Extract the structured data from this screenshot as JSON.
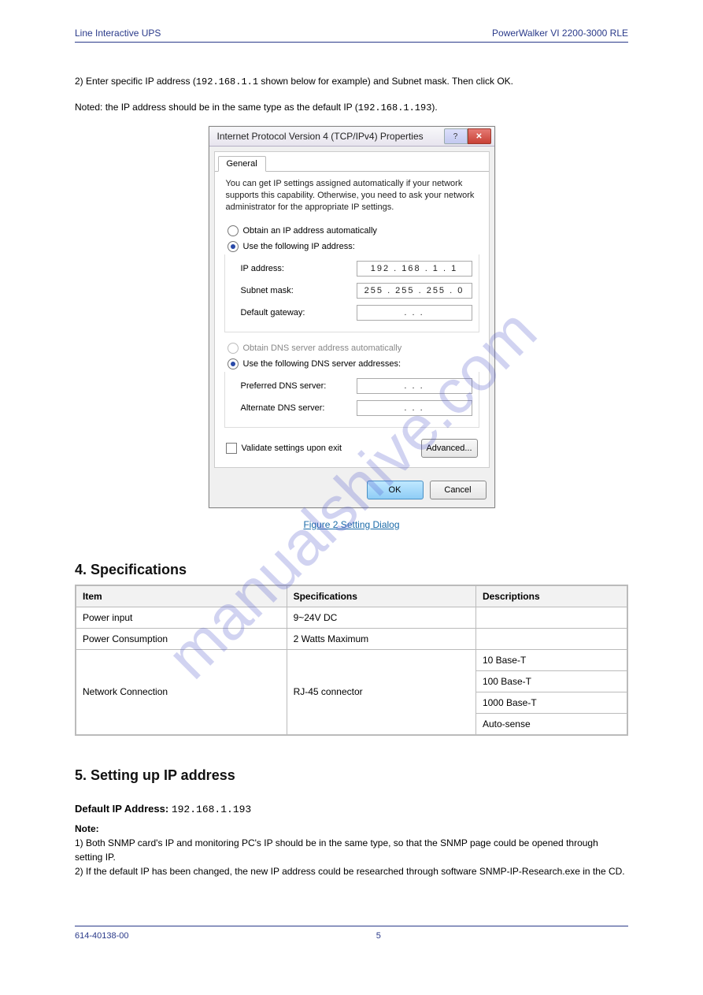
{
  "header": {
    "left": "Line Interactive UPS",
    "right": "PowerWalker VI 2200-3000 RLE"
  },
  "intro": {
    "p1_prefix": "2) Enter specific IP address (",
    "p1_ip": "192.168.1.1",
    "p1_suffix": " shown below for example) and Subnet mask. Then click OK.",
    "p2_prefix": "Noted: the IP address should be in the same type as the default IP (",
    "p2_ip": "192.168.1.193",
    "p2_suffix": ")."
  },
  "dialog": {
    "title": "Internet Protocol Version 4 (TCP/IPv4) Properties",
    "tab": "General",
    "info": "You can get IP settings assigned automatically if your network supports this capability. Otherwise, you need to ask your network administrator for the appropriate IP settings.",
    "radio_obtain_ip": "Obtain an IP address automatically",
    "radio_use_ip": "Use the following IP address:",
    "ip_label": "IP address:",
    "ip_value": "192 . 168 .  1  .  1",
    "subnet_label": "Subnet mask:",
    "subnet_value": "255 . 255 . 255 .  0",
    "gateway_label": "Default gateway:",
    "gateway_value": ".       .       .",
    "radio_obtain_dns": "Obtain DNS server address automatically",
    "radio_use_dns": "Use the following DNS server addresses:",
    "pref_dns_label": "Preferred DNS server:",
    "pref_dns_value": ".       .       .",
    "alt_dns_label": "Alternate DNS server:",
    "alt_dns_value": ".       .       .",
    "validate": "Validate settings upon exit",
    "advanced": "Advanced...",
    "ok": "OK",
    "cancel": "Cancel"
  },
  "figure_caption": "Figure 2 Setting Dialog",
  "section4": {
    "title": "4. Specifications",
    "table": {
      "headers": [
        "Item",
        "Specifications",
        "Descriptions"
      ],
      "rows": [
        {
          "item": "Power input",
          "spec": "9~24V DC",
          "desc": ""
        },
        {
          "item": "Power Consumption",
          "spec": "2 Watts Maximum",
          "desc": ""
        },
        {
          "item": "Network Connection",
          "spec": "RJ-45 connector",
          "rowspan": 4,
          "descs": [
            "10 Base-T",
            "100 Base-T",
            "1000 Base-T",
            "Auto-sense"
          ]
        }
      ]
    }
  },
  "section5": {
    "title": "5. Setting up IP address",
    "default_ip_label": "Default IP Address: ",
    "default_ip": "192.168.1.193",
    "warn_head": "Note:",
    "warn_text_1": "1) Both SNMP card's IP and monitoring PC's IP should be in the same type, so that the SNMP page could be opened through setting IP.",
    "warn_text_2": "2) If the default IP has been changed, the new IP address could be researched through software SNMP-IP-Research.exe in the CD."
  },
  "footer": {
    "left": "614-40138-00",
    "center": "5",
    "right": ""
  }
}
